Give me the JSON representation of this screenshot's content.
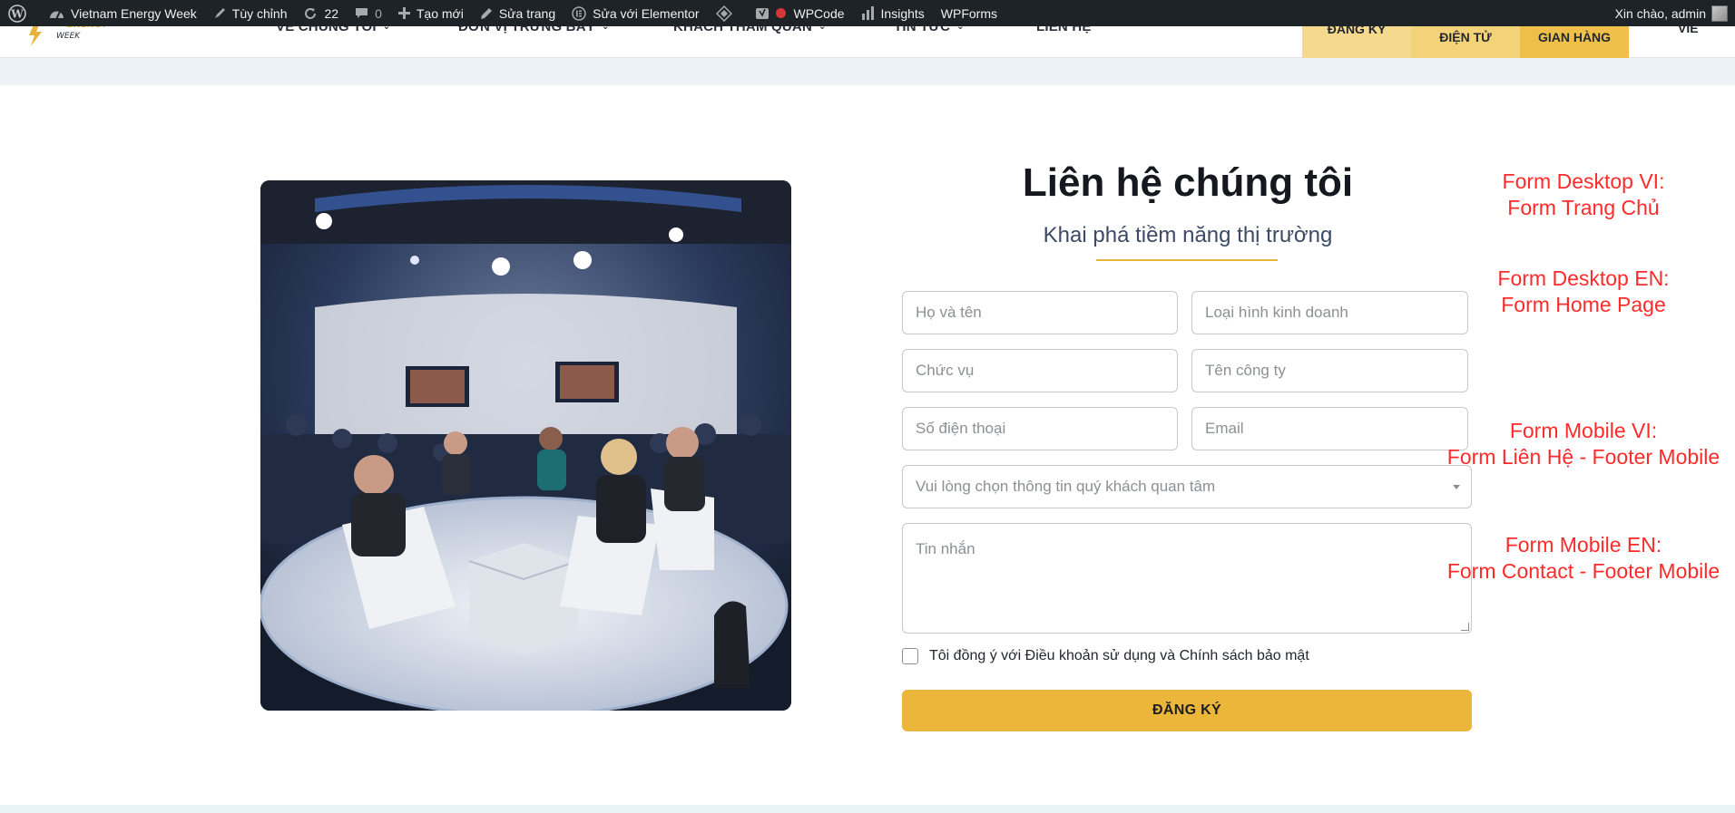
{
  "admin_bar": {
    "site_name": "Vietnam Energy Week",
    "customize": "Tùy chỉnh",
    "updates_count": "22",
    "comments_count": "0",
    "new_label": "Tạo mới",
    "edit_page": "Sửa trang",
    "edit_elementor": "Sửa với Elementor",
    "wpcode": "WPCode",
    "insights": "Insights",
    "wpforms": "WPForms",
    "greeting": "Xin chào, admin"
  },
  "header": {
    "nav": [
      {
        "label": "VỀ CHÚNG TÔI",
        "has_dropdown": true
      },
      {
        "label": "ĐƠN VỊ TRƯNG BÀY",
        "has_dropdown": true
      },
      {
        "label": "KHÁCH THAM QUAN",
        "has_dropdown": true
      },
      {
        "label": "TIN TỨC",
        "has_dropdown": true
      },
      {
        "label": "LIÊN HỆ",
        "has_dropdown": false
      }
    ],
    "buttons": [
      "ĐĂNG KÝ",
      "ĐIỆN TỬ",
      "GIAN HÀNG"
    ],
    "language": "VIE",
    "colors": {
      "btn1": "#f5d98d",
      "btn2": "#f4d277",
      "btn3": "#eec04a"
    }
  },
  "contact": {
    "title": "Liên hệ chúng tôi",
    "subtitle": "Khai phá tiềm năng thị trường",
    "fields": {
      "full_name": "Họ và tên",
      "business_type": "Loại hình kinh doanh",
      "position": "Chức vụ",
      "company": "Tên công ty",
      "phone": "Số điện thoại",
      "email": "Email",
      "interest": "Vui lòng chọn thông tin quý khách quan tâm",
      "message": "Tin nhắn"
    },
    "consent": "Tôi đồng ý với Điều khoản sử dụng và Chính sách bảo mật",
    "submit": "ĐĂNG KÝ",
    "accent_color": "#ebb63a"
  },
  "annotations": [
    {
      "line1": "Form Desktop VI:",
      "line2": "Form Trang Chủ"
    },
    {
      "line1": "Form Desktop EN:",
      "line2": "Form Home Page"
    },
    {
      "line1": "Form Mobile VI:",
      "line2": "Form Liên Hệ - Footer Mobile"
    },
    {
      "line1": "Form Mobile EN:",
      "line2": "Form Contact - Footer Mobile"
    }
  ]
}
